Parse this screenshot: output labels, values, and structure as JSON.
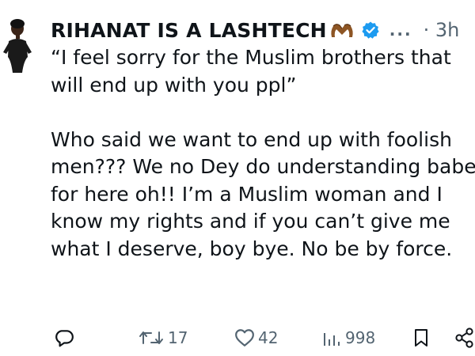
{
  "tweet": {
    "author_name": "RIHANAT IS A LASHTECH",
    "time": "3h",
    "more": "...",
    "quote_line": "“I feel sorry for the Muslim brothers that will end up with you ppl”",
    "body": "Who said we want to end up with foolish men??? We no Dey do understanding babe for here oh!! I’m a Muslim woman and I know my rights and if you can’t give me what I deserve, boy bye. No be by force."
  },
  "actions": {
    "retweets": "17",
    "likes": "42",
    "views": "998"
  },
  "icons": {
    "verified": "verified-badge-icon",
    "emoji": "heart-hands-emoji-icon",
    "reply": "reply-icon",
    "retweet": "retweet-icon",
    "like": "heart-icon",
    "views": "views-bar-chart-icon",
    "bookmark": "bookmark-icon",
    "share": "share-icon"
  },
  "colors": {
    "text": "#0f1419",
    "muted": "#536471",
    "verified": "#1d9bf0",
    "emoji_skin": "#8d5524"
  }
}
